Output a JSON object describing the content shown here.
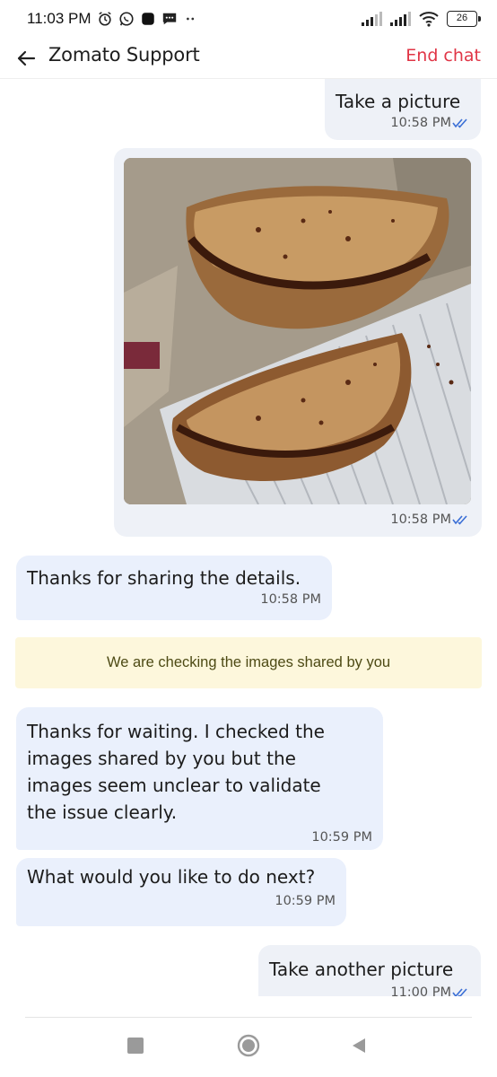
{
  "status_bar": {
    "time": "11:03 PM",
    "battery": "26",
    "icons": [
      "alarm-icon",
      "whatsapp-icon",
      "app-icon",
      "message-icon",
      "more-dots-icon",
      "signal-icon",
      "signal-icon",
      "wifi-icon",
      "battery-icon"
    ]
  },
  "header": {
    "back_icon": "back-arrow-icon",
    "title": "Zomato Support",
    "end_chat_label": "End chat",
    "end_chat_color": "#e03546"
  },
  "messages": [
    {
      "direction": "outgoing",
      "text": "Take a picture",
      "time": "10:58 PM",
      "read": true
    },
    {
      "direction": "outgoing",
      "type": "image",
      "image_desc": "photo-of-burnt-calzones",
      "time": "10:58 PM",
      "read": true
    },
    {
      "direction": "incoming",
      "text": "Thanks for sharing the details.",
      "time": "10:58 PM"
    },
    {
      "direction": "system",
      "text": "We are checking the images shared by you"
    },
    {
      "direction": "incoming",
      "lines": [
        "Thanks for waiting. I checked the",
        "images shared by you but the",
        "images seem unclear to validate",
        "the issue clearly."
      ],
      "time": "10:59 PM"
    },
    {
      "direction": "incoming",
      "text": "What would you like to do next?",
      "time": "10:59 PM"
    },
    {
      "direction": "outgoing",
      "text": "Take another picture",
      "time": "11:00 PM",
      "read": true
    }
  ],
  "colors": {
    "outgoing_bubble": "#eef1f7",
    "incoming_bubble": "#eaf0fc",
    "system_banner": "#fdf7dc",
    "read_tick": "#3b6fd6"
  },
  "navbar": {
    "buttons": [
      "recents-square-icon",
      "home-circle-icon",
      "back-triangle-icon"
    ]
  }
}
